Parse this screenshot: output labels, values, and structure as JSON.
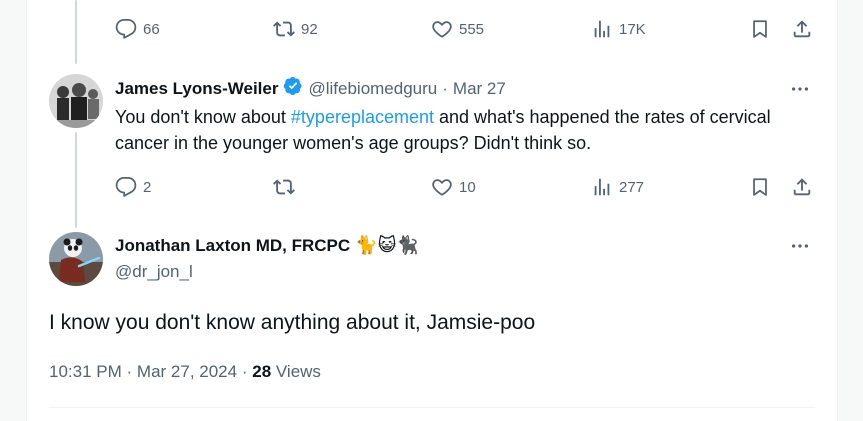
{
  "top_tweet_actions": {
    "replies": "66",
    "reposts": "92",
    "likes": "555",
    "views": "17K"
  },
  "reply": {
    "author_name": "James Lyons-Weiler",
    "handle": "@lifebiomedguru",
    "separator": "·",
    "date": "Mar 27",
    "text_before": "You don't know about ",
    "hashtag": "#typereplacement",
    "text_after": " and what's happened the rates of cervical cancer in the younger women's age groups?  Didn't think so.",
    "actions": {
      "replies": "2",
      "reposts": "",
      "likes": "10",
      "views": "277"
    }
  },
  "main": {
    "author_name": "Jonathan Laxton MD, FRCPC",
    "name_emoji": "🐈😺🐈‍⬛",
    "handle": "@dr_jon_l",
    "text": "I know you don't know anything about it, Jamsie-poo",
    "time": "10:31 PM",
    "separator1": "·",
    "date": "Mar 27, 2024",
    "separator2": "·",
    "views_count": "28",
    "views_label": "Views"
  },
  "colors": {
    "accent": "#1d9bf0",
    "verified": "#1d9bf0",
    "muted": "#536471",
    "text": "#0f1419"
  },
  "icons": [
    "reply-icon",
    "repost-icon",
    "like-icon",
    "views-icon",
    "bookmark-icon",
    "share-icon",
    "verified-badge-icon",
    "more-icon"
  ]
}
